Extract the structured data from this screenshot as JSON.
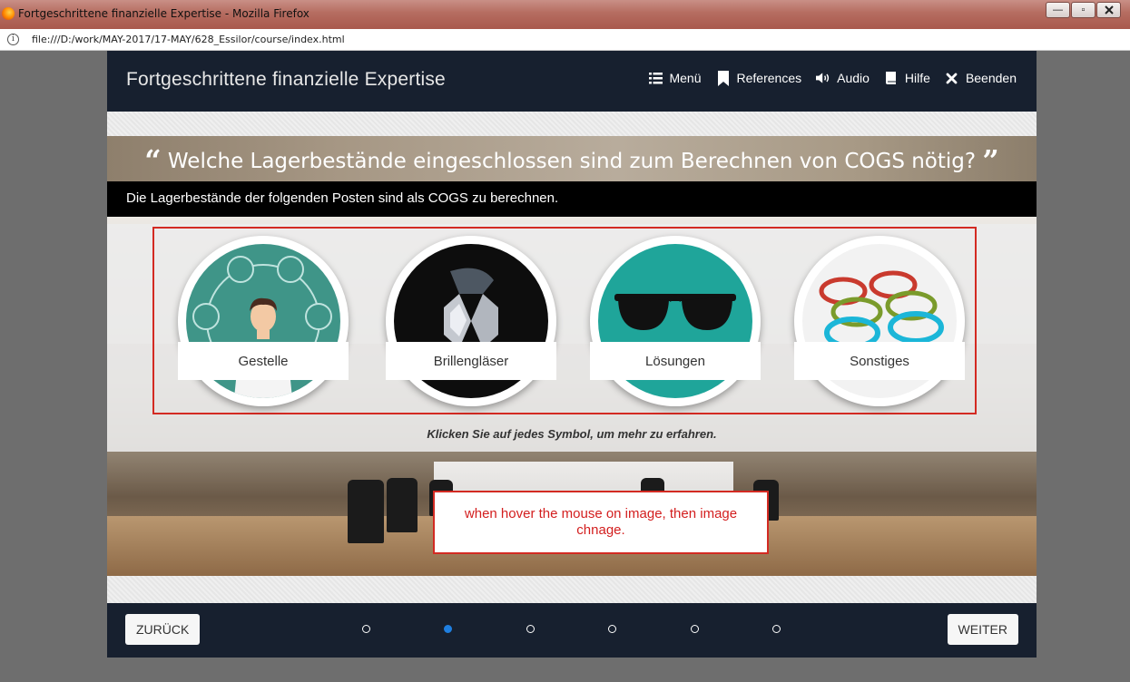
{
  "browser": {
    "window_title": "Fortgeschrittene finanzielle Expertise - Mozilla Firefox",
    "url": "file:///D:/work/MAY-2017/17-MAY/628_Essilor/course/index.html",
    "controls": {
      "minimize": "—",
      "maximize": "▫"
    }
  },
  "course": {
    "title": "Fortgeschrittene finanzielle Expertise",
    "nav": [
      {
        "label": "Menü",
        "icon": "list-icon"
      },
      {
        "label": "References",
        "icon": "bookmark-icon"
      },
      {
        "label": "Audio",
        "icon": "speaker-icon"
      },
      {
        "label": "Hilfe",
        "icon": "help-book-icon"
      },
      {
        "label": "Beenden",
        "icon": "close-icon"
      }
    ],
    "question": "Welche Lagerbestände eingeschlossen sind zum Berechnen von COGS nötig?",
    "quote_open": "“",
    "quote_close": "”",
    "subtitle": "Die Lagerbestände der folgenden Posten sind als COGS zu berechnen.",
    "cards": [
      {
        "label": "Gestelle",
        "icon": "doctor-illustration-icon",
        "bg": "#3f9588"
      },
      {
        "label": "Brillengläser",
        "icon": "diamond-lens-icon",
        "bg": "#0d0d0d"
      },
      {
        "label": "Lösungen",
        "icon": "sunglasses-icon",
        "bg": "#1fa59a"
      },
      {
        "label": "Sonstiges",
        "icon": "eyeglasses-photo-icon",
        "bg": "#f2f2f2"
      }
    ],
    "hint": "Klicken Sie auf jedes Symbol, um mehr zu erfahren.",
    "annotation": "when hover the mouse on image, then image chnage.",
    "footer": {
      "back_label": "ZURÜCK",
      "next_label": "WEITER",
      "pages": 6,
      "current_page": 2
    }
  },
  "colors": {
    "header_bg": "#17202f",
    "accent_blue": "#1f7fe0",
    "annotation_red": "#d32a22"
  }
}
